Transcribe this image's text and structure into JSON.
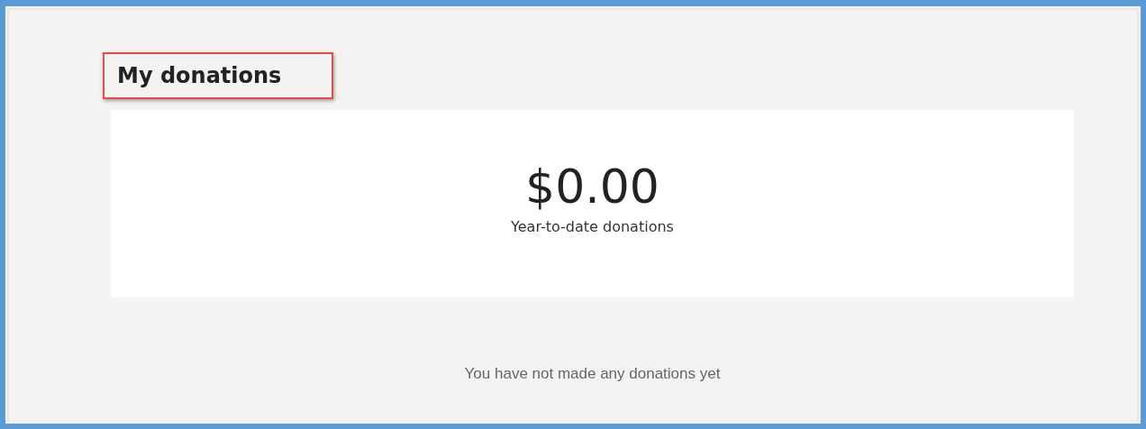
{
  "heading": {
    "text": "My donations",
    "highlighted": true
  },
  "summary": {
    "amount": "$0.00",
    "label": "Year-to-date donations"
  },
  "empty_message": "You have not made any donations yet"
}
